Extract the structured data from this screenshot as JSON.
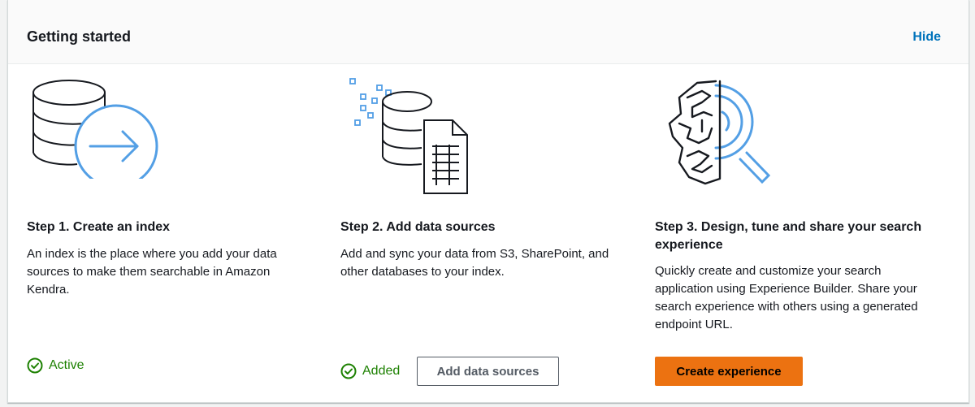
{
  "header": {
    "title": "Getting started",
    "hide_label": "Hide"
  },
  "steps": [
    {
      "title": "Step 1. Create an index",
      "description": "An index is the place where you add your data sources to make them searchable in Amazon Kendra.",
      "status": "Active",
      "icon": "database-arrow-illustration"
    },
    {
      "title": "Step 2. Add data sources",
      "description": "Add and sync your data from S3, SharePoint, and other databases to your index.",
      "status": "Added",
      "button_label": "Add data sources",
      "icon": "database-document-illustration"
    },
    {
      "title": "Step 3. Design, tune and share your search experience",
      "description": "Quickly create and customize your search application using Experience Builder. Share your search experience with others using a generated endpoint URL.",
      "button_label": "Create experience",
      "icon": "brain-search-illustration"
    }
  ],
  "colors": {
    "link": "#0073bb",
    "success": "#1d8102",
    "primary_button": "#ec7211",
    "illustration_blue": "#539fe5"
  }
}
